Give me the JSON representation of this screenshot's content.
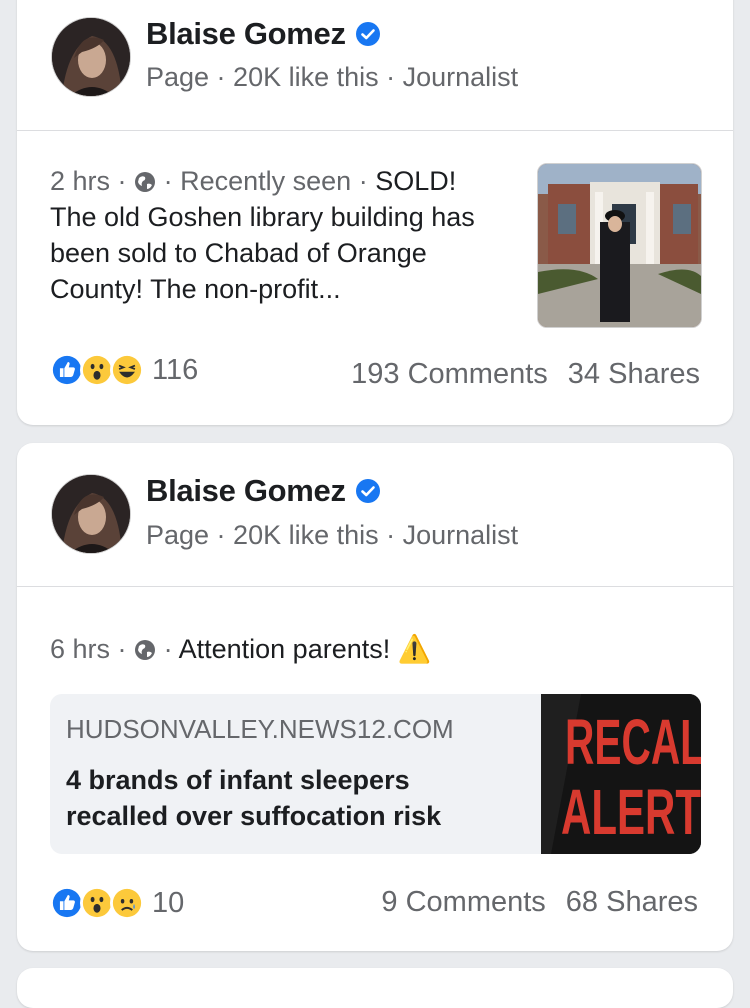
{
  "posts": [
    {
      "author": "Blaise Gomez",
      "subtitle": "Page · 20K like this · Journalist",
      "time": "2 hrs",
      "status": "Recently seen",
      "text": "SOLD! The old Goshen library building has been sold to Chabad of Orange County! The non-profit...",
      "reaction_count": "116",
      "comments": "193 Comments",
      "shares": "34 Shares",
      "reactions": [
        "like-icon",
        "wow-icon",
        "haha-icon"
      ]
    },
    {
      "author": "Blaise Gomez",
      "subtitle": "Page · 20K like this · Journalist",
      "time": "6 hrs",
      "text": "Attention parents! ⚠️",
      "link": {
        "domain": "HUDSONVALLEY.NEWS12.COM",
        "title": "4 brands of infant sleepers recalled over suffocation risk",
        "image_text_1": "RECAL",
        "image_text_2": "ALERT"
      },
      "reaction_count": "10",
      "comments": "9 Comments",
      "shares": "68 Shares",
      "reactions": [
        "like-icon",
        "wow-icon",
        "sad-icon"
      ]
    }
  ],
  "separator": "·",
  "colors": {
    "background": "#e9ebee",
    "card": "#ffffff",
    "secondary_text": "#65676b",
    "verified_blue": "#1877f2",
    "like_blue": "#1877f2",
    "emoji_yellow": "#fcc93b",
    "recall_red": "#d83a2f"
  }
}
